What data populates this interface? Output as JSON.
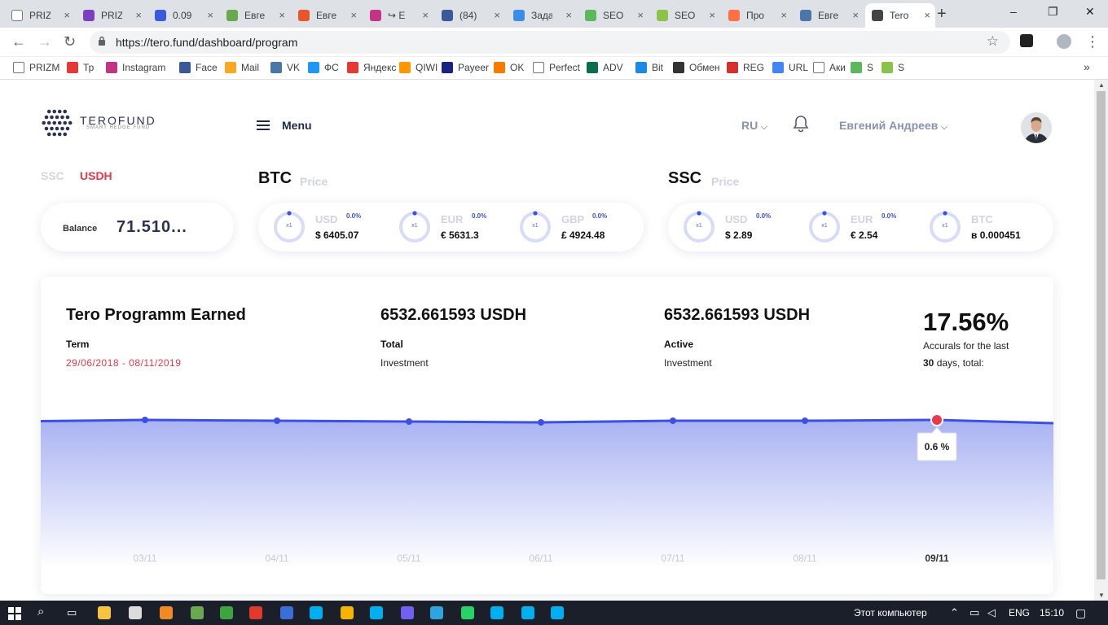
{
  "browser": {
    "tabs": [
      {
        "label": "PRIZ",
        "icon": "document-icon",
        "color": "#ffffff"
      },
      {
        "label": "PRIZ",
        "icon": "prizm-icon",
        "color": "#7b3fbf"
      },
      {
        "label": "0.09",
        "icon": "exchange-icon",
        "color": "#3b5bdb"
      },
      {
        "label": "Евге",
        "icon": "n-icon",
        "color": "#6aa84f"
      },
      {
        "label": "Евге",
        "icon": "f-icon",
        "color": "#e8572a"
      },
      {
        "label": "↪ Е",
        "icon": "instagram-icon",
        "color": "#c13584"
      },
      {
        "label": "(84)",
        "icon": "facebook-icon",
        "color": "#3b5998"
      },
      {
        "label": "Зада",
        "icon": "check-icon",
        "color": "#3a8ee6"
      },
      {
        "label": "SEO",
        "icon": "dollar-icon",
        "color": "#5cb85c"
      },
      {
        "label": "SEO",
        "icon": "sf-icon",
        "color": "#8bc34a"
      },
      {
        "label": "Про",
        "icon": "k-icon",
        "color": "#ff7043"
      },
      {
        "label": "Евге",
        "icon": "vk-icon",
        "color": "#4a76a8"
      },
      {
        "label": "Tero",
        "icon": "terofund-icon",
        "color": "#444444",
        "active": true
      }
    ],
    "url": "https://tero.fund/dashboard/program",
    "bookmarks": [
      {
        "label": "PRIZM",
        "icon": "document-icon",
        "color": "#ffffff"
      },
      {
        "label": "Тр",
        "icon": "star-icon",
        "color": "#e53935"
      },
      {
        "label": "Instagram",
        "icon": "instagram-icon",
        "color": "#c13584"
      },
      {
        "label": "Face",
        "icon": "facebook-icon",
        "color": "#3b5998"
      },
      {
        "label": "Mail",
        "icon": "mail-icon",
        "color": "#f9a825"
      },
      {
        "label": "VK",
        "icon": "vk-icon",
        "color": "#4a76a8"
      },
      {
        "label": "ФС",
        "icon": "fs-icon",
        "color": "#2196f3"
      },
      {
        "label": "Яндекс",
        "icon": "yandex-icon",
        "color": "#e53935"
      },
      {
        "label": "QIWI",
        "icon": "qiwi-icon",
        "color": "#ff9800"
      },
      {
        "label": "Payeer",
        "icon": "payeer-icon",
        "color": "#1a237e"
      },
      {
        "label": "OK",
        "icon": "ok-icon",
        "color": "#f57c00"
      },
      {
        "label": "Perfect",
        "icon": "document-icon",
        "color": "#ffffff"
      },
      {
        "label": "ADV",
        "icon": "adv-icon",
        "color": "#0b6e4f"
      },
      {
        "label": "Bit",
        "icon": "bit-icon",
        "color": "#1e88e5"
      },
      {
        "label": "Обмен",
        "icon": "bc-icon",
        "color": "#333333"
      },
      {
        "label": "REG",
        "icon": "reg-icon",
        "color": "#d32f2f"
      },
      {
        "label": "URL",
        "icon": "google-icon",
        "color": "#4285f4"
      },
      {
        "label": "Аки",
        "icon": "document-icon",
        "color": "#ffffff"
      },
      {
        "label": "S",
        "icon": "dollar-icon",
        "color": "#5cb85c"
      },
      {
        "label": "S",
        "icon": "sf-icon",
        "color": "#8bc34a"
      }
    ],
    "more_bookmarks": "»"
  },
  "header": {
    "logo_title": "TEROFUND",
    "logo_subtitle": "SMART HEDGE FUND",
    "menu_label": "Menu",
    "language": "RU",
    "username": "Евгений Андреев"
  },
  "balance": {
    "tabs": [
      "SSC",
      "USDH"
    ],
    "active_tab": "USDH",
    "label": "Balance",
    "value": "71.510..."
  },
  "btc": {
    "title": "BTC",
    "subtitle": "Price",
    "rates": [
      {
        "code": "USD",
        "change": "0.0%",
        "value": "$ 6405.07",
        "multiplier": "x1"
      },
      {
        "code": "EUR",
        "change": "0.0%",
        "value": "€ 5631.3",
        "multiplier": "x1"
      },
      {
        "code": "GBP",
        "change": "0.0%",
        "value": "£ 4924.48",
        "multiplier": "x1"
      }
    ]
  },
  "ssc": {
    "title": "SSC",
    "subtitle": "Price",
    "rates": [
      {
        "code": "USD",
        "change": "0.0%",
        "value": "$ 2.89",
        "multiplier": "x1"
      },
      {
        "code": "EUR",
        "change": "0.0%",
        "value": "€ 2.54",
        "multiplier": "x1"
      },
      {
        "code": "BTC",
        "change": "",
        "value": "в 0.000451",
        "multiplier": "x1"
      }
    ]
  },
  "program": {
    "title": "Tero Programm Earned",
    "term_label": "Term",
    "term_value": "29/06/2018 - 08/11/2019",
    "total_amount": "6532.661593 USDH",
    "total_label": "Total",
    "total_sub": "Investment",
    "active_amount": "6532.661593 USDH",
    "active_label": "Active",
    "active_sub": "Investment",
    "accruals_percent": "17.56%",
    "accruals_line1": "Accurals for the last",
    "accruals_days": "30",
    "accruals_line2": "days, total:"
  },
  "chart_data": {
    "type": "area",
    "categories": [
      "03/11",
      "04/11",
      "05/11",
      "06/11",
      "07/11",
      "08/11",
      "09/11"
    ],
    "values": [
      0.6,
      0.56,
      0.52,
      0.48,
      0.56,
      0.56,
      0.6
    ],
    "highlight_index": 6,
    "highlight_label": "0.6 %",
    "colors": {
      "line": "#3d50e6",
      "fill_top": "#a9b3f2",
      "marker": "#e8394a",
      "active_tick": "#333333",
      "tick": "#c5cad6"
    }
  },
  "taskbar": {
    "tray_text": "Этот компьютер",
    "language": "ENG",
    "time": "15:10"
  }
}
